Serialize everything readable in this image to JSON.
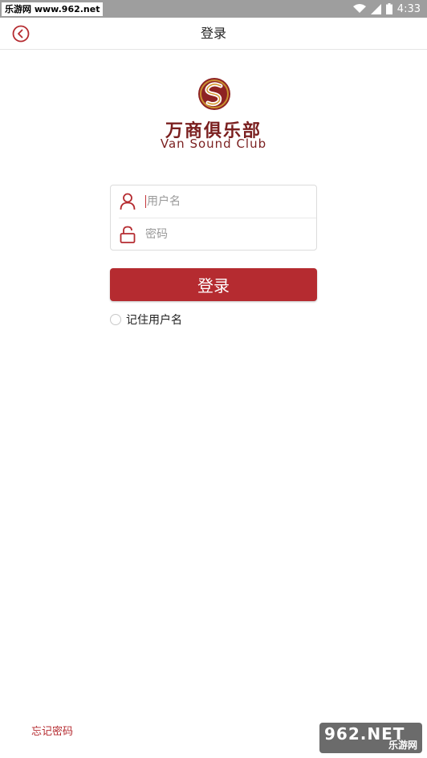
{
  "status_bar": {
    "watermark": "乐游网 www.962.net",
    "time": "4:33",
    "icons": [
      "wifi-icon",
      "signal-icon",
      "battery-icon"
    ]
  },
  "header": {
    "title": "登录",
    "back_icon": "chevron-left-circle-icon"
  },
  "brand": {
    "logo_icon": "s-swirl-logo",
    "name_cn": "万商俱乐部",
    "name_en": "Van Sound Club"
  },
  "form": {
    "username": {
      "value": "",
      "placeholder": "用户名",
      "icon": "user-icon"
    },
    "password": {
      "value": "",
      "placeholder": "密码",
      "icon": "lock-icon"
    },
    "login_label": "登录",
    "remember_label": "记住用户名"
  },
  "footer": {
    "forgot_label": "忘记密码",
    "watermark_top": "962.NET",
    "watermark_bottom": "乐游网"
  },
  "colors": {
    "accent": "#b52b30",
    "brand_text": "#7a1f1f",
    "status_bar": "#9e9e9e"
  }
}
